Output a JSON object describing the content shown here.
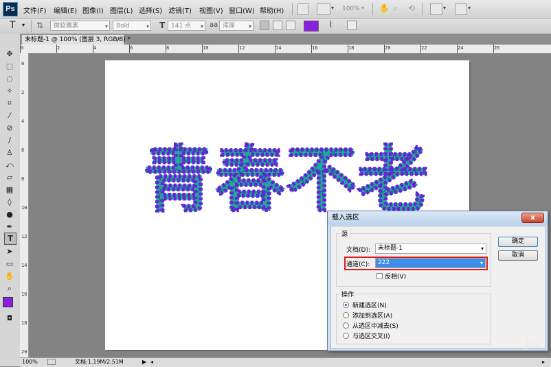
{
  "app": {
    "logo": "Ps",
    "brand_color": "#0a2d4f"
  },
  "menu": [
    "文件(F)",
    "编辑(E)",
    "图像(I)",
    "图层(L)",
    "选择(S)",
    "滤镜(T)",
    "视图(V)",
    "窗口(W)",
    "帮助(H)"
  ],
  "menubar_extras": {
    "zoom": "100%"
  },
  "options": {
    "font_family": "微软雅黑",
    "font_style": "Bold",
    "font_size": "141 点",
    "antialias": "浑厚",
    "text_color": "#8a1fe0"
  },
  "document": {
    "tab_title": "未标题-1 @ 100% (图层 3, RGB/8) *",
    "text": "青春不老",
    "text_fill": "#22a596",
    "selection_color": "#6a1fd8"
  },
  "ruler": {
    "h": [
      "0",
      "2",
      "4",
      "6",
      "8",
      "10",
      "12",
      "14",
      "16",
      "18",
      "20",
      "22",
      "24",
      "26"
    ],
    "v": [
      "0",
      "2",
      "4",
      "6",
      "8",
      "10",
      "12",
      "14",
      "16",
      "18",
      "20"
    ]
  },
  "status": {
    "zoom": "100%",
    "doc_info": "文档:1.19M/2.51M"
  },
  "colors": {
    "foreground": "#8a1fe0",
    "background": "#000000"
  },
  "dialog": {
    "title": "载入选区",
    "close": "x",
    "source_group": "源",
    "doc_label": "文档(D):",
    "doc_value": "未标题-1",
    "channel_label": "通道(C):",
    "channel_value": "222",
    "invert_label": "反相(V)",
    "op_group": "操作",
    "operations": [
      "新建选区(N)",
      "添加到选区(A)",
      "从选区中减去(S)",
      "与选区交叉(I)"
    ],
    "ok": "确定",
    "cancel": "取消",
    "highlight_color": "#dd1a1a"
  },
  "watermark": "Jiu"
}
